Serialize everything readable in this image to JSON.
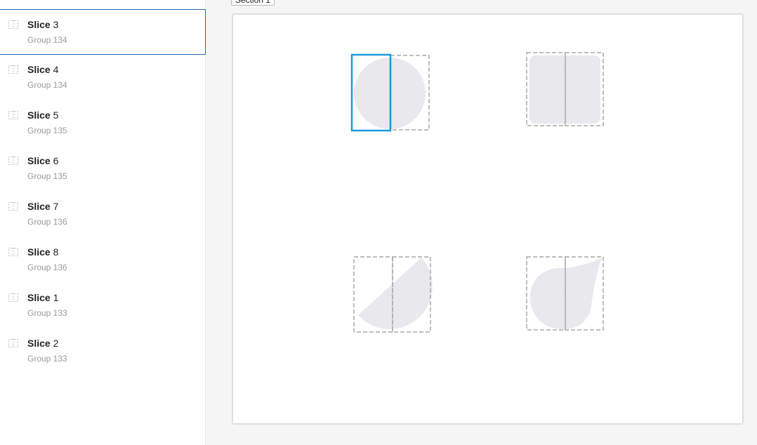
{
  "layers": [
    {
      "kw": "Slice",
      "num": "3",
      "group": "Group 134",
      "selected": true
    },
    {
      "kw": "Slice",
      "num": "4",
      "group": "Group 134",
      "selected": false
    },
    {
      "kw": "Slice",
      "num": "5",
      "group": "Group 135",
      "selected": false
    },
    {
      "kw": "Slice",
      "num": "6",
      "group": "Group 135",
      "selected": false
    },
    {
      "kw": "Slice",
      "num": "7",
      "group": "Group 136",
      "selected": false
    },
    {
      "kw": "Slice",
      "num": "8",
      "group": "Group 136",
      "selected": false
    },
    {
      "kw": "Slice",
      "num": "1",
      "group": "Group 133",
      "selected": false
    },
    {
      "kw": "Slice",
      "num": "2",
      "group": "Group 133",
      "selected": false
    }
  ],
  "section": {
    "label": "Section 1"
  },
  "colors": {
    "accent": "#1a9ae0",
    "shape_fill": "#e8e8ed",
    "slice_dash": "#a9a9a9",
    "selection_border": "#1e6fb8"
  }
}
